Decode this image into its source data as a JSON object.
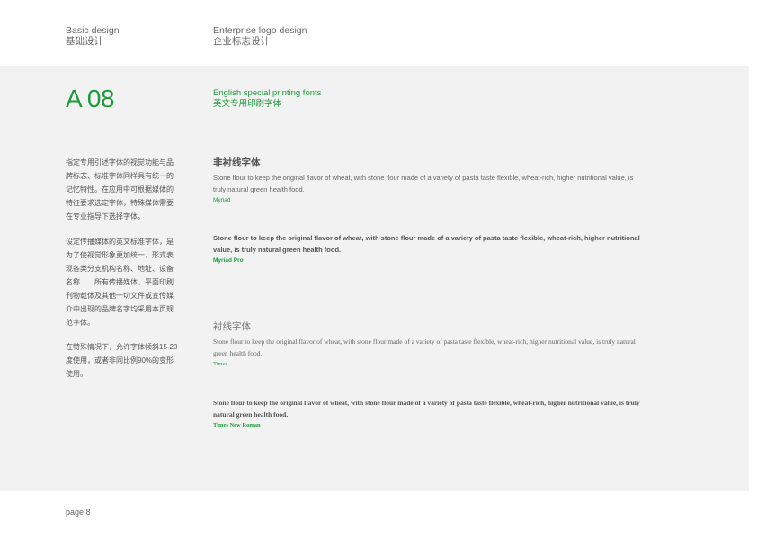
{
  "header": {
    "left_en": "Basic design",
    "left_zh": "基础设计",
    "right_en": "Enterprise logo design",
    "right_zh": "企业标志设计"
  },
  "section": {
    "code": "A 08",
    "title_en": "English special printing fonts",
    "title_zh": "英文专用印刷字体"
  },
  "sidebar": {
    "paragraphs": [
      "指定专用引述字体的视觉功能与品牌标志、标准字体同样具有统一的记忆特性。在应用中可根据媒体的特征要求选定字体，特殊媒体需要在专业指导下选择字体。",
      "设定传播媒体的英文标准字体，是为了使视觉形象更加统一，形式表现各类分支机构名称、地址、设备名称……所有传播媒体、平面印刷刊物载体及其他一切文件或宣传媒介中出现的品牌名字均采用本页规范字体。",
      "在特殊情况下，允许字体倾斜15-20度使用，或者非同比例90%的变形使用。"
    ]
  },
  "sans_group": {
    "heading": "非衬线字体",
    "regular_sample": "Stone flour to keep the original flavor of wheat, with stone flour made of a variety of pasta taste flexible, wheat-rich, higher nutritional value, is truly natural green health food.",
    "regular_font": "Myriad",
    "bold_sample": "Stone flour to keep the original flavor of wheat, with stone flour made of a variety of pasta taste flexible, wheat-rich, higher nutritional value, is truly natural green health food.",
    "bold_font": "Myriad Pro"
  },
  "serif_group": {
    "heading": "衬线字体",
    "regular_sample": "Stone flour to keep the original flavor of wheat, with stone flour made of a variety of pasta taste flexible, wheat-rich, higher nutritional value, is truly natural green health food.",
    "regular_font": "Times",
    "bold_sample": "Stone flour to keep the original flavor of wheat, with stone flour made of a variety of pasta taste flexible, wheat-rich, higher nutritional value, is truly natural green health food.",
    "bold_font": "Times New Roman"
  },
  "footer": {
    "page": "page 8"
  },
  "colors": {
    "accent": "#1d9a3c",
    "band": "#f2f2f2",
    "text": "#555555"
  }
}
